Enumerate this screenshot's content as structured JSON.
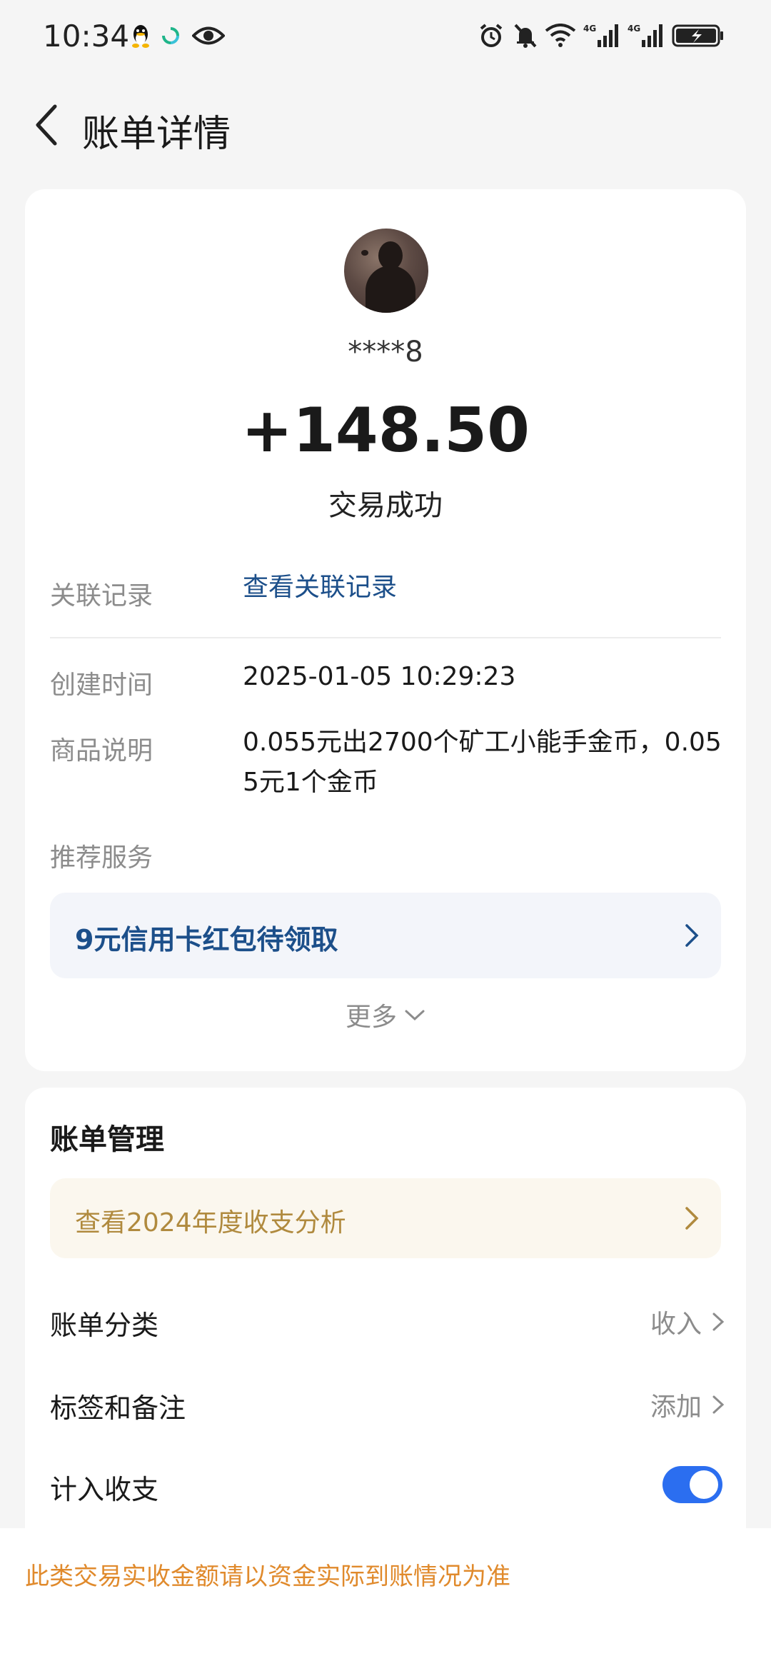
{
  "status_bar": {
    "time": "10:34",
    "left_icons": [
      "qq-icon",
      "refresh-app-icon",
      "eye-icon"
    ],
    "right_icons": [
      "alarm-icon",
      "mute-bell-icon",
      "wifi-icon",
      "signal-4g-icon",
      "signal-4g-icon",
      "battery-charging-icon"
    ]
  },
  "nav": {
    "title": "账单详情",
    "back_icon": "chevron-left-icon"
  },
  "transaction": {
    "payer_name": "****8",
    "amount": "+148.50",
    "status": "交易成功",
    "related_label": "关联记录",
    "related_link": "查看关联记录",
    "created_label": "创建时间",
    "created_value": "2025-01-05 10:29:23",
    "goods_label": "商品说明",
    "goods_line1": "0.055元出2700个矿工小能手金币，0.05",
    "goods_line2": "5元1个金币",
    "recommend_label": "推荐服务",
    "promo_text": "9元信用卡红包待领取",
    "more_label": "更多"
  },
  "management": {
    "title": "账单管理",
    "analysis_text": "查看2024年度收支分析",
    "category_label": "账单分类",
    "category_value": "收入",
    "tags_label": "标签和备注",
    "tags_value": "添加",
    "count_label": "计入收支",
    "count_enabled": true
  },
  "notice": {
    "text": "此类交易实收金额请以资金实际到账情况为准"
  },
  "colors": {
    "link_blue": "#1c4f8a",
    "toggle_blue": "#2b6ef0",
    "notice_orange": "#e08a2c",
    "analysis_gold": "#b08a3e"
  }
}
